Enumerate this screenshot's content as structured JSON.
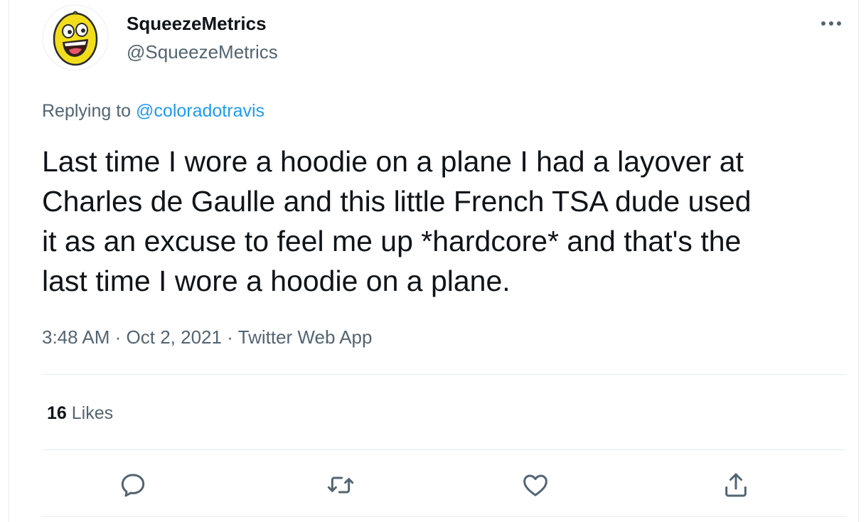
{
  "author": {
    "display_name": "SqueezeMetrics",
    "handle": "@SqueezeMetrics",
    "avatar_icon": "lemon-face-avatar"
  },
  "more_icon": "more-horizontal-icon",
  "reply_context": {
    "prefix": "Replying to",
    "mention": "@coloradotravis"
  },
  "tweet": {
    "lines": [
      "Last time I wore a hoodie on a plane I had a layover at",
      "Charles de Gaulle and this little French TSA dude used",
      "it as an excuse to feel me up *hardcore* and that's the",
      "last time I wore a hoodie on a plane."
    ]
  },
  "meta": {
    "time": "3:48 AM",
    "separator": "·",
    "date": "Oct 2, 2021",
    "source": "Twitter Web App"
  },
  "stats": {
    "likes_count": "16",
    "likes_label": "Likes"
  },
  "actions": [
    {
      "name": "reply",
      "icon": "reply-icon"
    },
    {
      "name": "retweet",
      "icon": "retweet-icon"
    },
    {
      "name": "like",
      "icon": "heart-icon"
    },
    {
      "name": "share",
      "icon": "share-icon"
    }
  ],
  "colors": {
    "text_primary": "#0f1419",
    "text_secondary": "#536471",
    "link": "#1d9bf0",
    "divider": "#e6ecf0",
    "avatar_lemon": "#f2dd1c"
  }
}
